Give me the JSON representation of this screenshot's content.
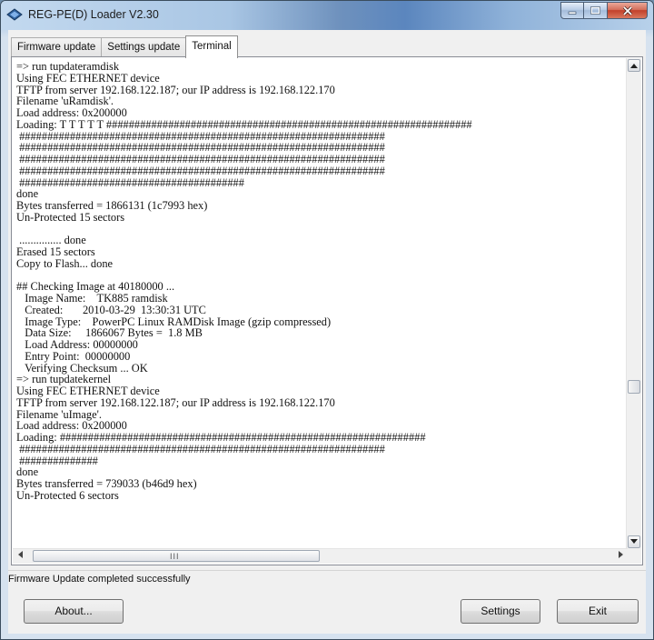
{
  "window": {
    "title": "REG-PE(D) Loader V2.30"
  },
  "tabs": [
    {
      "label": "Firmware update"
    },
    {
      "label": "Settings update"
    },
    {
      "label": "Terminal"
    }
  ],
  "terminal": {
    "lines": [
      "=> run tupdateramdisk",
      "Using FEC ETHERNET device",
      "TFTP from server 192.168.122.187; our IP address is 192.168.122.170",
      "Filename 'uRamdisk'.",
      "Load address: 0x200000",
      "Loading: T T T T T #################################################################",
      " #################################################################",
      " #################################################################",
      " #################################################################",
      " #################################################################",
      " ########################################",
      "done",
      "Bytes transferred = 1866131 (1c7993 hex)",
      "Un-Protected 15 sectors",
      "",
      " ............... done",
      "Erased 15 sectors",
      "Copy to Flash... done",
      "",
      "## Checking Image at 40180000 ...",
      "   Image Name:    TK885 ramdisk",
      "   Created:       2010-03-29  13:30:31 UTC",
      "   Image Type:    PowerPC Linux RAMDisk Image (gzip compressed)",
      "   Data Size:     1866067 Bytes =  1.8 MB",
      "   Load Address: 00000000",
      "   Entry Point:  00000000",
      "   Verifying Checksum ... OK",
      "=> run tupdatekernel",
      "Using FEC ETHERNET device",
      "TFTP from server 192.168.122.187; our IP address is 192.168.122.170",
      "Filename 'uImage'.",
      "Load address: 0x200000",
      "Loading: #################################################################",
      " #################################################################",
      " ##############",
      "done",
      "Bytes transferred = 739033 (b46d9 hex)",
      "Un-Protected 6 sectors"
    ]
  },
  "status_text": "Firmware Update completed successfully",
  "buttons": {
    "about": "About...",
    "settings": "Settings",
    "exit": "Exit"
  },
  "scrollbar": {
    "grip": "III"
  }
}
